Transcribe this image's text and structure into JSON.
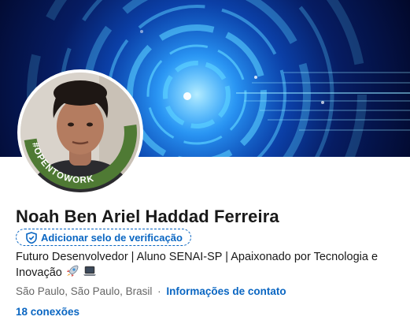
{
  "profile": {
    "name": "Noah Ben Ariel Haddad Ferreira",
    "verify_label": "Adicionar selo de verificação",
    "headline_text": "Futuro Desenvolvedor | Aluno SENAI-SP | Apaixonado por Tecnologia e Inovação",
    "headline_icons": [
      "rocket-icon",
      "laptop-icon"
    ],
    "location": "São Paulo, São Paulo, Brasil",
    "separator": "·",
    "contact_link": "Informações de contato",
    "connections": "18 conexões",
    "open_to_work_badge": "#OPENTOWORK"
  },
  "colors": {
    "link": "#0a66c2",
    "open_to_work_ring": "#4f7a34",
    "banner_accent": "#1a7de8"
  }
}
